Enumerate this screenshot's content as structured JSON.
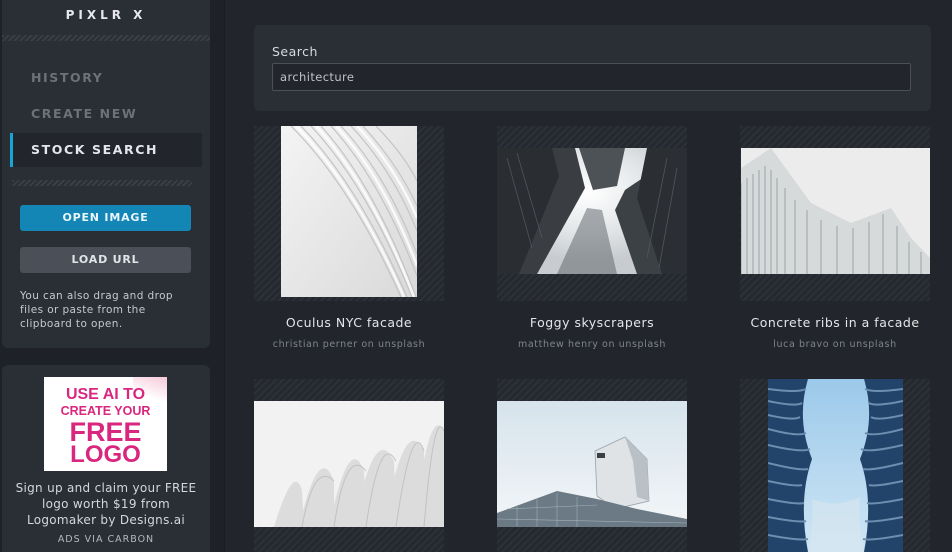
{
  "app": {
    "brand": "PIXLR X"
  },
  "sidebar": {
    "nav": [
      {
        "label": "HISTORY"
      },
      {
        "label": "CREATE NEW"
      },
      {
        "label": "STOCK SEARCH",
        "active": true
      }
    ],
    "open_image_label": "OPEN IMAGE",
    "load_url_label": "LOAD URL",
    "drag_note": "You can also drag and drop files or paste from the clipboard to open."
  },
  "ad": {
    "image_lines": [
      "USE AI TO",
      "CREATE YOUR",
      "FREE",
      "LOGO"
    ],
    "text": "Sign up and claim your FREE logo worth $19 from Logomaker by Designs.ai",
    "via": "ADS VIA CARBON"
  },
  "search": {
    "label": "Search",
    "value": "architecture"
  },
  "results": [
    {
      "title": "Oculus NYC facade",
      "credit": "christian perner on unsplash"
    },
    {
      "title": "Foggy skyscrapers",
      "credit": "matthew henry on unsplash"
    },
    {
      "title": "Concrete ribs in a facade",
      "credit": "luca bravo on unsplash"
    },
    {
      "title": "",
      "credit": ""
    },
    {
      "title": "",
      "credit": ""
    },
    {
      "title": "",
      "credit": ""
    }
  ],
  "colors": {
    "accent": "#17a5d8",
    "primary_button": "#1386b6",
    "secondary_button": "#4a4f58",
    "background": "#22262c",
    "panel": "#2a2e35"
  }
}
